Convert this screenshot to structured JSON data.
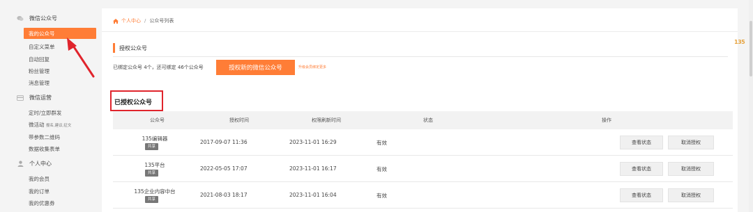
{
  "sidebar": {
    "groups": [
      {
        "label": "微信公众号",
        "icon": "chat-bubble-icon"
      },
      {
        "label": "微信运营",
        "icon": "card-icon"
      },
      {
        "label": "个人中心",
        "icon": "user-icon"
      }
    ],
    "wechat_items": [
      "我的公众号",
      "自定义菜单",
      "自动回复",
      "粉丝管理",
      "消息管理"
    ],
    "ops_items": [
      "定时/立即群发",
      "微活动",
      "带参数二维码",
      "数据收集表单"
    ],
    "ops_note": "报名,建议,征文",
    "personal_items": [
      "我的会员",
      "我的订单",
      "我的优惠券"
    ]
  },
  "breadcrumb": {
    "home": "个人中心",
    "current": "公众号列表"
  },
  "section": {
    "title": "授权公众号"
  },
  "bind_status": "已绑定公众号 4个，还可绑定 46个公众号",
  "auth_button": "授权新的微信公众号",
  "upgrade_link": "升级会员绑定更多",
  "authed_title": "已授权公众号",
  "table": {
    "headers": [
      "公众号",
      "授权时间",
      "权限刷新时间",
      "状态",
      "操作"
    ],
    "rows": [
      {
        "name": "135编辑器",
        "tag": "共享",
        "auth_time": "2017-09-07 11:36",
        "refresh_time": "2023-11-01 16:29",
        "status": "有效"
      },
      {
        "name": "135平台",
        "tag": "共享",
        "auth_time": "2022-05-05 17:07",
        "refresh_time": "2023-11-01 16:17",
        "status": "有效"
      },
      {
        "name": "135企业内容中台",
        "tag": "共享",
        "auth_time": "2021-08-03 18:17",
        "refresh_time": "2023-11-01 16:04",
        "status": "有效"
      }
    ],
    "view_label": "查看状态",
    "cancel_label": "取消授权"
  },
  "badge": "135",
  "colors": {
    "accent": "#ff7d36",
    "highlight": "#e0242c"
  }
}
